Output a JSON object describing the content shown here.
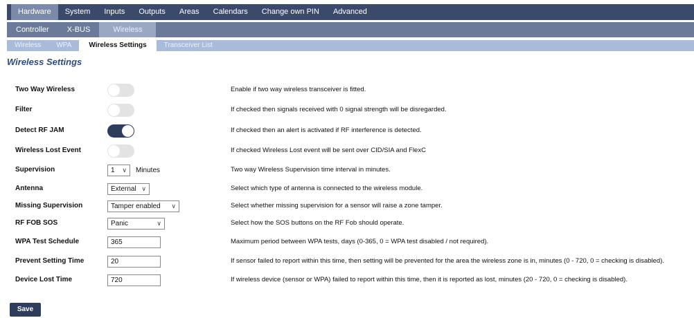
{
  "nav_primary": [
    "Hardware",
    "System",
    "Inputs",
    "Outputs",
    "Areas",
    "Calendars",
    "Change own PIN",
    "Advanced"
  ],
  "nav_secondary": [
    "Controller",
    "X-BUS",
    "Wireless"
  ],
  "nav_tertiary": [
    "Wireless",
    "WPA",
    "Wireless Settings",
    "Transceiver List"
  ],
  "page_title": "Wireless Settings",
  "settings": {
    "two_way": {
      "label": "Two Way Wireless",
      "enabled": false,
      "desc": "Enable if two way wireless transceiver is fitted."
    },
    "filter": {
      "label": "Filter",
      "enabled": false,
      "desc": "If checked then signals received with 0 signal strength will be disregarded."
    },
    "rf_jam": {
      "label": "Detect RF JAM",
      "enabled": true,
      "desc": "If checked then an alert is activated if RF interference is detected."
    },
    "lost_event": {
      "label": "Wireless Lost Event",
      "enabled": false,
      "desc": "If checked Wireless Lost event will be sent over CID/SIA and FlexC"
    },
    "supervision": {
      "label": "Supervision",
      "value": "1",
      "unit": "Minutes",
      "desc": "Two way Wireless Supervision time interval in minutes."
    },
    "antenna": {
      "label": "Antenna",
      "value": "External",
      "desc": "Select which type of antenna is connected to the wireless module."
    },
    "missing_supervision": {
      "label": "Missing Supervision",
      "value": "Tamper enabled",
      "desc": "Select whether missing supervision for a sensor will raise a zone tamper."
    },
    "rf_fob_sos": {
      "label": "RF FOB SOS",
      "value": "Panic",
      "desc": "Select how the SOS buttons on the RF Fob should operate."
    },
    "wpa_test": {
      "label": "WPA Test Schedule",
      "value": "365",
      "desc": "Maximum period between WPA tests, days (0-365, 0 = WPA test disabled / not required)."
    },
    "prevent_setting": {
      "label": "Prevent Setting Time",
      "value": "20",
      "desc": "If sensor failed to report within this time, then setting will be prevented for the area the wireless zone is in, minutes (0 - 720, 0 = checking is disabled)."
    },
    "device_lost": {
      "label": "Device Lost Time",
      "value": "720",
      "desc": "If wireless device (sensor or WPA) failed to report within this time, then it is reported as lost, minutes (20 - 720, 0 = checking is disabled)."
    }
  },
  "save_label": "Save",
  "icons": {
    "chevron": "chevron-down-icon"
  },
  "colors": {
    "nav_primary": "#3b4a6b",
    "nav_secondary": "#6a7a98",
    "nav_tertiary": "#a8bbd8",
    "accent": "#2e3d5c",
    "title": "#2d4b80"
  }
}
